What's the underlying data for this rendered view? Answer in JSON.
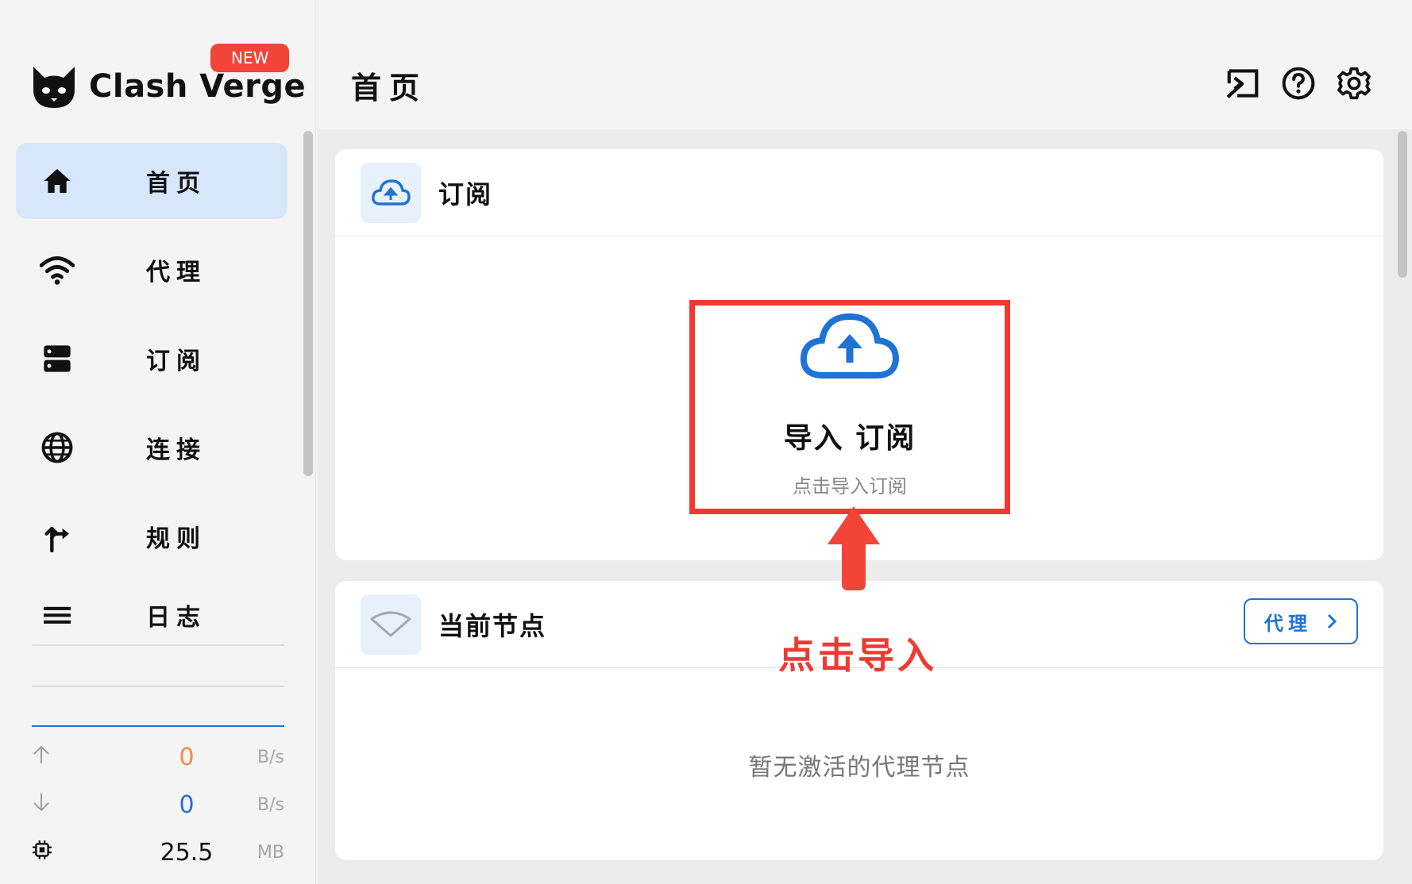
{
  "app": {
    "name": "Clash Verge",
    "badge": "NEW"
  },
  "nav": {
    "items": [
      {
        "label": "首页",
        "icon": "home-icon",
        "active": true
      },
      {
        "label": "代理",
        "icon": "wifi-icon",
        "active": false
      },
      {
        "label": "订阅",
        "icon": "server-icon",
        "active": false
      },
      {
        "label": "连接",
        "icon": "globe-icon",
        "active": false
      },
      {
        "label": "规则",
        "icon": "route-icon",
        "active": false
      },
      {
        "label": "日志",
        "icon": "list-icon",
        "active": false
      }
    ]
  },
  "stats": {
    "upload": {
      "value": "0",
      "unit": "B/s",
      "color": "#f08a4b"
    },
    "download": {
      "value": "0",
      "unit": "B/s",
      "color": "#1f73d6"
    },
    "memory": {
      "value": "25.5",
      "unit": "MB"
    }
  },
  "header": {
    "title": "首页",
    "icons": [
      "terminal-icon",
      "help-icon",
      "settings-icon"
    ]
  },
  "subscription_card": {
    "title": "订阅",
    "import_title": "导入 订阅",
    "import_subtitle": "点击导入订阅"
  },
  "node_card": {
    "title": "当前节点",
    "button_label": "代理",
    "empty_text": "暂无激活的代理节点"
  },
  "annotation": {
    "text": "点击导入",
    "color": "#ee3a32"
  },
  "colors": {
    "accent": "#1f73d6",
    "active_nav_bg": "#d7e6fa",
    "highlight_red": "#ee3a32"
  }
}
